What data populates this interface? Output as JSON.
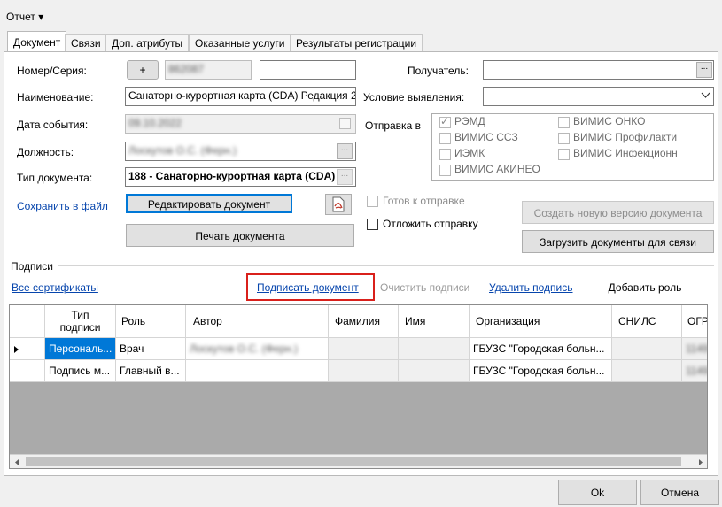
{
  "menu": {
    "report": "Отчет ▾"
  },
  "tabs": [
    "Документ",
    "Связи",
    "Доп. атрибуты",
    "Оказанные услуги",
    "Результаты регистрации"
  ],
  "form": {
    "number_label": "Номер/Серия:",
    "plus_label": "+",
    "number_value": "862087",
    "name_label": "Наименование:",
    "name_value": "Санаторно-курортная карта (CDA) Редакция 2",
    "date_label": "Дата события:",
    "date_value": "09.10.2022",
    "position_label": "Должность:",
    "position_value": "Лоскутов О.С. (Ферн.)",
    "doctype_label": "Тип документа:",
    "doctype_value": "188 - Санаторно-курортная карта (CDA)",
    "recipient_label": "Получатель:",
    "condition_label": "Условие выявления:",
    "send_label": "Отправка в",
    "ellipsis": "..."
  },
  "send_targets": [
    {
      "label": "РЭМД",
      "checked": true
    },
    {
      "label": "ВИМИС ОНКО",
      "checked": false
    },
    {
      "label": "ВИМИС ССЗ",
      "checked": false
    },
    {
      "label": "ВИМИС Профилакти",
      "checked": false
    },
    {
      "label": "ИЭМК",
      "checked": false
    },
    {
      "label": "ВИМИС Инфекционн",
      "checked": false
    },
    {
      "label": "ВИМИС АКИНЕО",
      "checked": false
    }
  ],
  "actions": {
    "save_to_file": "Сохранить в файл",
    "edit_document": "Редактировать документ",
    "print_document": "Печать документа",
    "ready_to_send": "Готов к отправке",
    "postpone_send": "Отложить отправку",
    "create_version": "Создать новую версию документа",
    "load_documents": "Загрузить документы для связи"
  },
  "signatures": {
    "section_label": "Подписи",
    "all_certs": "Все сертификаты",
    "sign_document": "Подписать документ",
    "clear_signature": "Очистить подписи",
    "delete_signature": "Удалить подпись",
    "add_role": "Добавить роль",
    "columns": [
      "Тип подписи",
      "Роль",
      "Автор",
      "Фамилия",
      "Имя",
      "Организация",
      "СНИЛС",
      "ОГР"
    ],
    "rows": [
      {
        "type": "Персональ...",
        "role": "Врач",
        "author": "Лоскутов О.С. (Ферн.)",
        "surname": "",
        "name": "",
        "org": "ГБУЗС \"Городская больн...",
        "snils": "",
        "ogr": "1149"
      },
      {
        "type": "Подпись м...",
        "role": "Главный в...",
        "author": "",
        "surname": "",
        "name": "",
        "org": "ГБУЗС \"Городская больн...",
        "snils": "",
        "ogr": "1149"
      }
    ]
  },
  "footer": {
    "ok": "Ok",
    "cancel": "Отмена"
  }
}
